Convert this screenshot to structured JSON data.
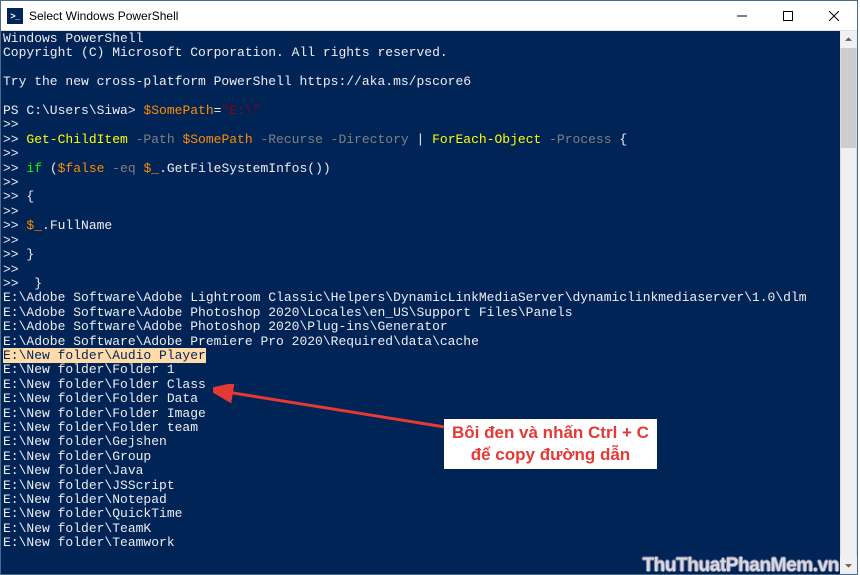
{
  "title": "Select Windows PowerShell",
  "icon_label": ">_",
  "terminal": {
    "banner1": "Windows PowerShell",
    "banner2": "Copyright (C) Microsoft Corporation. All rights reserved.",
    "banner3": "Try the new cross-platform PowerShell https://aka.ms/pscore6",
    "prompt_path": "PS C:\\Users\\Siwa> ",
    "var_somepath": "$SomePath",
    "eq": "=",
    "val_e": "\"E:\\\"",
    "cont": ">>",
    "cont_sp": ">> ",
    "cmd_gci": "Get-ChildItem",
    "p_path": " -Path ",
    "p_rec_dir": " -Recurse -Directory ",
    "pipe": "| ",
    "cmd_foreach": "ForEach-Object",
    "p_process": " -Process ",
    "brace_open": "{",
    "kw_if": "if ",
    "paren_open": "(",
    "var_false": "$false",
    "op_eq": " -eq ",
    "var_item": "$_",
    "method_gfi": ".GetFileSystemInfos()",
    "paren_close": ")",
    "method_fn": ".FullName",
    "brace_close1": " }",
    "brace_close2": "  }",
    "out1": "E:\\Adobe Software\\Adobe Lightroom Classic\\Helpers\\DynamicLinkMediaServer\\dynamiclinkmediaserver\\1.0\\dlm",
    "out2": "E:\\Adobe Software\\Adobe Photoshop 2020\\Locales\\en_US\\Support Files\\Panels",
    "out3": "E:\\Adobe Software\\Adobe Photoshop 2020\\Plug-ins\\Generator",
    "out4": "E:\\Adobe Software\\Adobe Premiere Pro 2020\\Required\\data\\cache",
    "out5_hl": "E:\\New folder\\Audio Player",
    "out6": "E:\\New folder\\Folder 1",
    "out7": "E:\\New folder\\Folder Class",
    "out8": "E:\\New folder\\Folder Data",
    "out9": "E:\\New folder\\Folder Image",
    "out10": "E:\\New folder\\Folder team",
    "out11": "E:\\New folder\\Gejshen",
    "out12": "E:\\New folder\\Group",
    "out13": "E:\\New folder\\Java",
    "out14": "E:\\New folder\\JSScript",
    "out15": "E:\\New folder\\Notepad",
    "out16": "E:\\New folder\\QuickTime",
    "out17": "E:\\New folder\\TeamK",
    "out18": "E:\\New folder\\Teamwork"
  },
  "annotation": {
    "line1": "Bôi đen và nhấn Ctrl + C",
    "line2": "để copy đường dẫn"
  },
  "watermark": "ThuThuatPhanMem.vn"
}
